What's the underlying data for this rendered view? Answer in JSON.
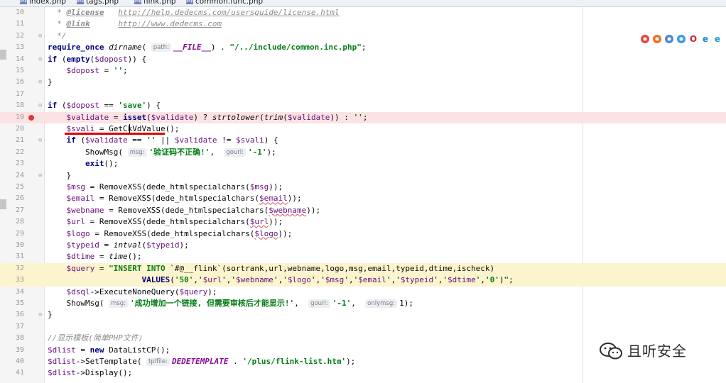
{
  "tabs": [
    {
      "label": "index.php",
      "active": false
    },
    {
      "label": "tags.php",
      "active": false
    },
    {
      "label": "flink.php",
      "active": true
    },
    {
      "label": "common.func.php",
      "active": false
    }
  ],
  "browser_icons": [
    "chrome-icon",
    "firefox-icon",
    "chromium-icon",
    "safari-icon",
    "opera-icon",
    "ie-icon",
    "edge-icon"
  ],
  "watermark": {
    "icon": "wechat-logo-icon",
    "text": "且听安全"
  },
  "editor": {
    "colors": {
      "breakpoint_line": "#fbe3e4",
      "highlight_line": "#fcf4cf",
      "breakpoint_dot": "#d9383a",
      "annotation_underline": "#e00000"
    },
    "lines": [
      {
        "n": "10",
        "fold": "",
        "t": [
          [
            "c",
            "  * "
          ],
          [
            "tg",
            "@license"
          ],
          [
            "c",
            "   "
          ],
          [
            "url",
            "http://help.dedecms.com/usersguide/license.html"
          ]
        ]
      },
      {
        "n": "11",
        "fold": "",
        "t": [
          [
            "c",
            "  * "
          ],
          [
            "tg",
            "@link"
          ],
          [
            "c",
            "      "
          ],
          [
            "url",
            "http://www.dedecms.com"
          ]
        ]
      },
      {
        "n": "12",
        "fold": "⊖",
        "t": [
          [
            "c",
            "  */"
          ]
        ]
      },
      {
        "n": "13",
        "fold": "",
        "t": [
          [
            "k",
            "require_once "
          ],
          [
            "f",
            "dirname"
          ],
          [
            "p",
            "( "
          ],
          [
            "h",
            "path:"
          ],
          [
            "cst",
            "__FILE__"
          ],
          [
            "p",
            ") . "
          ],
          [
            "s",
            "\"/../include/common.inc.php\""
          ],
          [
            "p",
            ";"
          ]
        ]
      },
      {
        "n": "14",
        "fold": "⊖",
        "t": [
          [
            "k",
            "if "
          ],
          [
            "p",
            "("
          ],
          [
            "k",
            "empty"
          ],
          [
            "p",
            "("
          ],
          [
            "v",
            "$dopost"
          ],
          [
            "p",
            ")) {"
          ]
        ]
      },
      {
        "n": "15",
        "fold": "",
        "t": [
          [
            "p",
            "    "
          ],
          [
            "v",
            "$dopost"
          ],
          [
            "p",
            " = "
          ],
          [
            "s",
            "''"
          ],
          [
            "p",
            ";"
          ]
        ]
      },
      {
        "n": "16",
        "fold": "⊖",
        "t": [
          [
            "p",
            "}"
          ]
        ]
      },
      {
        "n": "17",
        "fold": "",
        "t": []
      },
      {
        "n": "18",
        "fold": "⊖",
        "t": [
          [
            "k",
            "if "
          ],
          [
            "p",
            "("
          ],
          [
            "v",
            "$dopost"
          ],
          [
            "p",
            " == "
          ],
          [
            "s",
            "'save'"
          ],
          [
            "p",
            ") {"
          ]
        ]
      },
      {
        "n": "19",
        "fold": "",
        "bp": true,
        "t": [
          [
            "p",
            "    "
          ],
          [
            "v",
            "$validate"
          ],
          [
            "p",
            " = "
          ],
          [
            "k",
            "isset"
          ],
          [
            "p",
            "("
          ],
          [
            "v",
            "$validate"
          ],
          [
            "p",
            ") ? "
          ],
          [
            "f",
            "strtolower"
          ],
          [
            "p",
            "("
          ],
          [
            "f",
            "trim"
          ],
          [
            "p",
            "("
          ],
          [
            "v",
            "$validate"
          ],
          [
            "p",
            ")) : "
          ],
          [
            "s",
            "''"
          ],
          [
            "p",
            ";"
          ]
        ]
      },
      {
        "n": "20",
        "fold": "",
        "t": [
          [
            "p",
            "    "
          ],
          [
            "v",
            "$svali"
          ],
          [
            "p",
            " = GetCkVdValue();"
          ]
        ]
      },
      {
        "n": "21",
        "fold": "⊖",
        "t": [
          [
            "p",
            "    "
          ],
          [
            "k",
            "if "
          ],
          [
            "p",
            "("
          ],
          [
            "v",
            "$validate"
          ],
          [
            "p",
            " == "
          ],
          [
            "s",
            "''"
          ],
          [
            "p",
            " || "
          ],
          [
            "v",
            "$validate"
          ],
          [
            "p",
            " != "
          ],
          [
            "v",
            "$svali"
          ],
          [
            "p",
            ") {"
          ]
        ]
      },
      {
        "n": "22",
        "fold": "",
        "t": [
          [
            "p",
            "        ShowMsg( "
          ],
          [
            "h",
            "msg:"
          ],
          [
            "s",
            "'验证码不正确!'"
          ],
          [
            "p",
            ",  "
          ],
          [
            "h",
            "gourl:"
          ],
          [
            "s",
            "'-1'"
          ],
          [
            "p",
            ");"
          ]
        ]
      },
      {
        "n": "23",
        "fold": "",
        "t": [
          [
            "p",
            "        "
          ],
          [
            "k",
            "exit"
          ],
          [
            "p",
            "();"
          ]
        ]
      },
      {
        "n": "24",
        "fold": "⊖",
        "t": [
          [
            "p",
            "    }"
          ]
        ]
      },
      {
        "n": "25",
        "fold": "",
        "t": [
          [
            "p",
            "    "
          ],
          [
            "v",
            "$msg"
          ],
          [
            "p",
            " = RemoveXSS(dede_htmlspecialchars("
          ],
          [
            "v",
            "$msg"
          ],
          [
            "p",
            "));"
          ]
        ]
      },
      {
        "n": "26",
        "fold": "",
        "t": [
          [
            "p",
            "    "
          ],
          [
            "v",
            "$email"
          ],
          [
            "p",
            " = RemoveXSS(dede_htmlspecialchars("
          ],
          [
            "vq",
            "$email"
          ],
          [
            "p",
            "));"
          ]
        ]
      },
      {
        "n": "27",
        "fold": "",
        "t": [
          [
            "p",
            "    "
          ],
          [
            "v",
            "$webname"
          ],
          [
            "p",
            " = RemoveXSS(dede_htmlspecialchars("
          ],
          [
            "vq",
            "$webname"
          ],
          [
            "p",
            "));"
          ]
        ]
      },
      {
        "n": "28",
        "fold": "",
        "t": [
          [
            "p",
            "    "
          ],
          [
            "v",
            "$url"
          ],
          [
            "p",
            " = RemoveXSS(dede_htmlspecialchars("
          ],
          [
            "vq",
            "$url"
          ],
          [
            "p",
            "));"
          ]
        ]
      },
      {
        "n": "29",
        "fold": "",
        "t": [
          [
            "p",
            "    "
          ],
          [
            "v",
            "$logo"
          ],
          [
            "p",
            " = RemoveXSS(dede_htmlspecialchars("
          ],
          [
            "vq",
            "$logo"
          ],
          [
            "p",
            "));"
          ]
        ]
      },
      {
        "n": "30",
        "fold": "",
        "t": [
          [
            "p",
            "    "
          ],
          [
            "v",
            "$typeid"
          ],
          [
            "p",
            " = "
          ],
          [
            "f",
            "intval"
          ],
          [
            "p",
            "("
          ],
          [
            "v",
            "$typeid"
          ],
          [
            "p",
            ");"
          ]
        ]
      },
      {
        "n": "31",
        "fold": "",
        "t": [
          [
            "p",
            "    "
          ],
          [
            "v",
            "$dtime"
          ],
          [
            "p",
            " = "
          ],
          [
            "f",
            "time"
          ],
          [
            "p",
            "();"
          ]
        ]
      },
      {
        "n": "32",
        "fold": "",
        "hl": true,
        "t": [
          [
            "p",
            "    "
          ],
          [
            "v",
            "$query"
          ],
          [
            "p",
            " = "
          ],
          [
            "s",
            "\"INSERT INTO "
          ],
          [
            "p",
            "`#@__flink`(sortrank,url,webname,logo,msg,email,typeid,dtime,ischeck)"
          ]
        ]
      },
      {
        "n": "33",
        "fold": "",
        "hl": true,
        "t": [
          [
            "p",
            "                    "
          ],
          [
            "k",
            "VALUES"
          ],
          [
            "p",
            "("
          ],
          [
            "s",
            "'50'"
          ],
          [
            "p",
            ","
          ],
          [
            "s",
            "'"
          ],
          [
            "v",
            "$url"
          ],
          [
            "s",
            "'"
          ],
          [
            "p",
            ","
          ],
          [
            "s",
            "'"
          ],
          [
            "v",
            "$webname"
          ],
          [
            "s",
            "'"
          ],
          [
            "p",
            ","
          ],
          [
            "s",
            "'"
          ],
          [
            "v",
            "$logo"
          ],
          [
            "s",
            "'"
          ],
          [
            "p",
            ","
          ],
          [
            "s",
            "'"
          ],
          [
            "v",
            "$msg"
          ],
          [
            "s",
            "'"
          ],
          [
            "p",
            ","
          ],
          [
            "s",
            "'"
          ],
          [
            "v",
            "$email"
          ],
          [
            "s",
            "'"
          ],
          [
            "p",
            ","
          ],
          [
            "s",
            "'"
          ],
          [
            "v",
            "$typeid"
          ],
          [
            "s",
            "'"
          ],
          [
            "p",
            ","
          ],
          [
            "s",
            "'"
          ],
          [
            "v",
            "$dtime"
          ],
          [
            "s",
            "'"
          ],
          [
            "p",
            ","
          ],
          [
            "s",
            "'0'"
          ],
          [
            "p",
            ")"
          ],
          [
            "s",
            "\""
          ],
          [
            "p",
            ";"
          ]
        ]
      },
      {
        "n": "34",
        "fold": "",
        "t": [
          [
            "p",
            "    "
          ],
          [
            "v",
            "$dsql"
          ],
          [
            "p",
            "->ExecuteNoneQuery("
          ],
          [
            "v",
            "$query"
          ],
          [
            "p",
            ");"
          ]
        ]
      },
      {
        "n": "35",
        "fold": "",
        "t": [
          [
            "p",
            "    ShowMsg( "
          ],
          [
            "h",
            "msg:"
          ],
          [
            "s",
            "'成功增加一个链接, 但需要审核后才能显示!'"
          ],
          [
            "p",
            ",  "
          ],
          [
            "h",
            "gourl:"
          ],
          [
            "s",
            "'-1'"
          ],
          [
            "p",
            ",  "
          ],
          [
            "h",
            "onlymsg:"
          ],
          [
            "p",
            "1);"
          ]
        ]
      },
      {
        "n": "36",
        "fold": "⊖",
        "t": [
          [
            "p",
            "}"
          ]
        ]
      },
      {
        "n": "37",
        "fold": "",
        "t": []
      },
      {
        "n": "38",
        "fold": "",
        "t": [
          [
            "c",
            "//显示模板(简单PHP文件)"
          ]
        ]
      },
      {
        "n": "39",
        "fold": "",
        "t": [
          [
            "v",
            "$dlist"
          ],
          [
            "p",
            " = "
          ],
          [
            "k",
            "new "
          ],
          [
            "p",
            "DataListCP();"
          ]
        ]
      },
      {
        "n": "40",
        "fold": "",
        "t": [
          [
            "v",
            "$dlist"
          ],
          [
            "p",
            "->SetTemplate( "
          ],
          [
            "h",
            "tplfile:"
          ],
          [
            "cst",
            "DEDETEMPLATE"
          ],
          [
            "p",
            " . "
          ],
          [
            "s",
            "'/plus/flink-list.htm'"
          ],
          [
            "p",
            ");"
          ]
        ]
      },
      {
        "n": "41",
        "fold": "",
        "t": [
          [
            "v",
            "$dlist"
          ],
          [
            "p",
            "->Display();"
          ]
        ]
      }
    ]
  }
}
